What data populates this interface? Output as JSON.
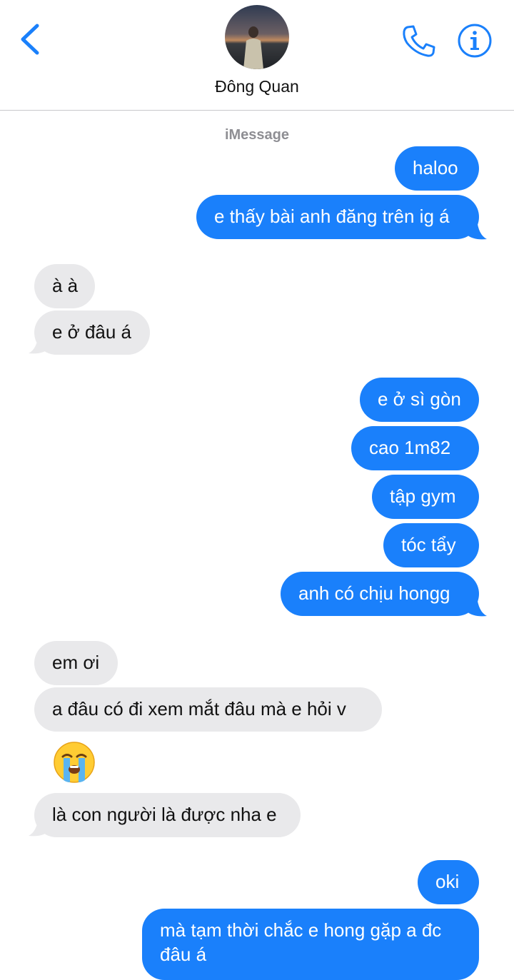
{
  "header": {
    "contact_name": "Đông Quan",
    "back_icon": "chevron-left-icon",
    "call_icon": "phone-icon",
    "info_icon": "info-icon",
    "accent_color": "#1a80fb"
  },
  "thread": {
    "service_label": "iMessage",
    "messages": [
      {
        "dir": "out",
        "text": "haloo"
      },
      {
        "dir": "out",
        "text": "e thấy bài anh đăng trên ig á"
      },
      {
        "dir": "in",
        "text": "à à"
      },
      {
        "dir": "in",
        "text": "e ở đâu á"
      },
      {
        "dir": "out",
        "text": "e ở sì gòn"
      },
      {
        "dir": "out",
        "text": "cao 1m82"
      },
      {
        "dir": "out",
        "text": "tập gym"
      },
      {
        "dir": "out",
        "text": "tóc tẩy"
      },
      {
        "dir": "out",
        "text": "anh có chịu hongg"
      },
      {
        "dir": "in",
        "text": "em ơi"
      },
      {
        "dir": "in",
        "text": "a đâu có đi xem mắt đâu mà e hỏi v"
      },
      {
        "dir": "in",
        "emoji": "loudly-crying-face"
      },
      {
        "dir": "in",
        "text": "là con người là được nha e"
      },
      {
        "dir": "out",
        "text": "oki"
      },
      {
        "dir": "out",
        "text": "mà tạm thời chắc e hong gặp a đc đâu á"
      }
    ]
  }
}
